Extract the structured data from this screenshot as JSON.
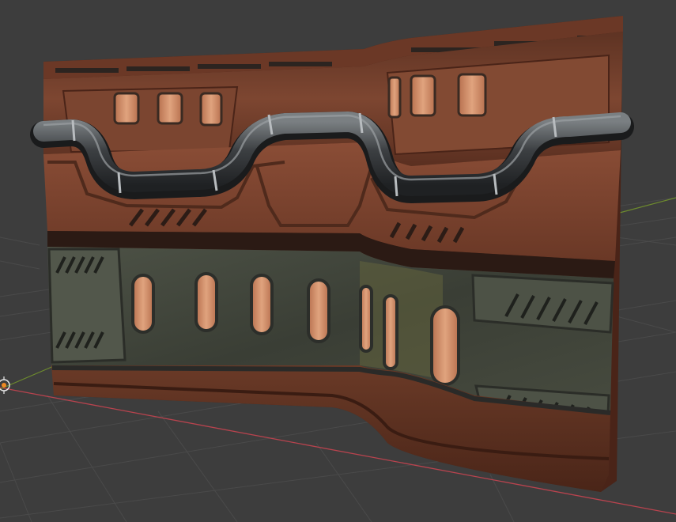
{
  "app": "3D Viewport",
  "colors": {
    "background": "#3d3d3d",
    "grid_line": "#4a4a4a",
    "x_axis": "#b8434e",
    "y_axis": "#6d8a2e",
    "wood": "#7a4530",
    "wood_dark": "#4a2418",
    "metal": "#3e433a",
    "metal_light": "#5b6152",
    "window_glow": "#d3906a",
    "pipe": "#45484b",
    "origin_marker": "#f08a24"
  },
  "icons": {
    "origin": "origin-marker-icon"
  }
}
